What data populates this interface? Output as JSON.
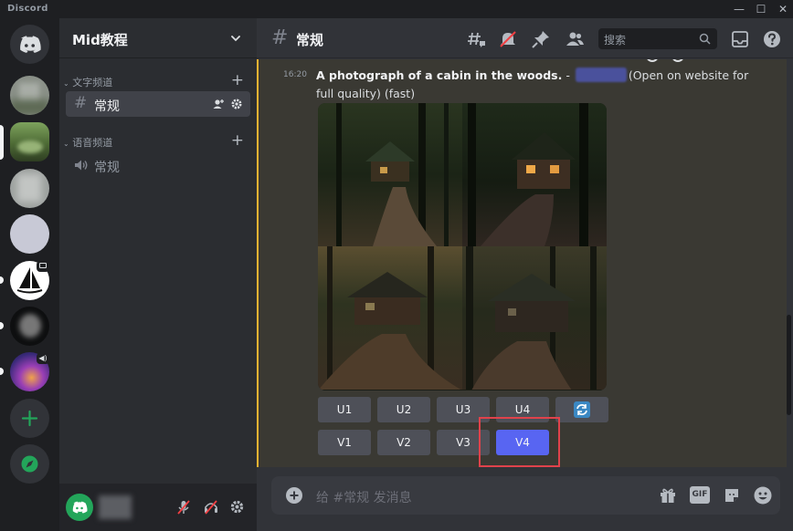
{
  "app": {
    "name": "Discord"
  },
  "window_controls": {
    "minimize": "—",
    "maximize": "☐",
    "close": "✕"
  },
  "servers": [
    {
      "name": "blurred-server-1"
    },
    {
      "name": "forest-server",
      "selected": true
    },
    {
      "name": "blurred-server-3"
    },
    {
      "name": "blank-server"
    },
    {
      "name": "midjourney-server"
    },
    {
      "name": "dark-server"
    },
    {
      "name": "purple-server"
    }
  ],
  "guild": {
    "name": "Mid教程",
    "categories": [
      {
        "label": "文字频道",
        "channels": [
          {
            "label": "常规",
            "type": "text",
            "active": true
          }
        ]
      },
      {
        "label": "语音频道",
        "channels": [
          {
            "label": "常规",
            "type": "voice",
            "active": false
          }
        ]
      }
    ]
  },
  "channel": {
    "hash": "#",
    "name": "常规"
  },
  "search": {
    "placeholder": "搜索"
  },
  "message": {
    "time": "16:20",
    "prompt": "A photograph of a cabin in the woods.",
    "separator": " - ",
    "trailing": "(Open on website for full quality) (fast)",
    "upscale_buttons": [
      "U1",
      "U2",
      "U3",
      "U4"
    ],
    "variation_buttons": [
      "V1",
      "V2",
      "V3",
      "V4"
    ],
    "highlighted_button": "V4"
  },
  "composer": {
    "placeholder": "给 #常规 发消息",
    "gif_label": "GIF"
  },
  "colors": {
    "accent": "#5865f2",
    "highlight_box": "#e0424b",
    "mention_bar": "#f0b232",
    "green": "#23a55a"
  }
}
